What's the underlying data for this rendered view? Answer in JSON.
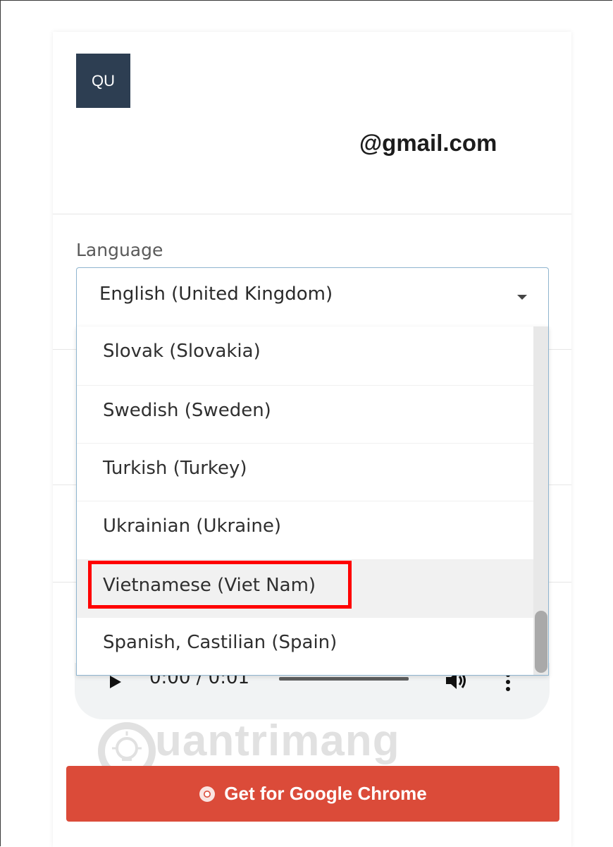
{
  "account": {
    "avatar_initials": "QU",
    "email": "@gmail.com"
  },
  "language": {
    "label": "Language",
    "selected": "English (United Kingdom)",
    "options": [
      {
        "label": "Slovak (Slovakia)"
      },
      {
        "label": "Swedish (Sweden)"
      },
      {
        "label": "Turkish (Turkey)"
      },
      {
        "label": "Ukrainian (Ukraine)"
      },
      {
        "label": "Vietnamese (Viet Nam)",
        "hovered": true,
        "highlighted": true
      },
      {
        "label": "Spanish, Castilian (Spain)"
      }
    ]
  },
  "audio_player": {
    "time": "0:00 / 0:01",
    "icons": [
      "play-icon",
      "volume-icon",
      "more-vertical-icon"
    ]
  },
  "cta": {
    "label": "Get for Google Chrome",
    "icon": "chrome-icon",
    "color": "#db4b39"
  },
  "watermark": {
    "text": "uantrimang"
  },
  "colors": {
    "avatar_bg": "#2d3e52",
    "highlight_box": "#ff0000",
    "select_border": "#8fb5cf"
  }
}
